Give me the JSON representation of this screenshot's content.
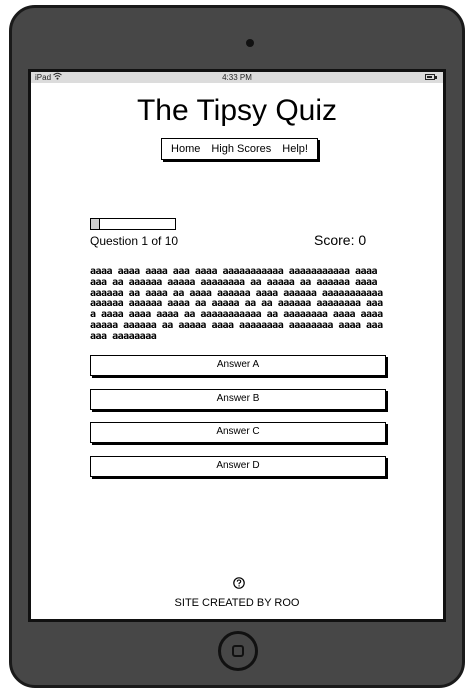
{
  "status_bar": {
    "carrier": "iPad",
    "time": "4:33 PM",
    "wifi_icon": "wifi-icon",
    "battery_icon": "battery-icon"
  },
  "app": {
    "title": "The Tipsy Quiz"
  },
  "nav": {
    "items": [
      "Home",
      "High Scores",
      "Help!"
    ]
  },
  "quiz": {
    "progress_fraction": 0.1,
    "question_counter": "Question 1 of 10",
    "score": "Score: 0",
    "question_text": "aaaa aaaa aaaa aaa aaaa aaaaaaaaaaa aaaaaaaaaaa aaaa aaa aa aaaaaa aaaaa aaaaaaaa aa aaaaa aa aaaaaa aaaa aaaaaa aa aaaa aa aaaa aaaaaa aaaa aaaaaa aaaaaaaaaaa aaaaaa aaaaaa aaaa aa aaaaa aa aa aaaaaa aaaaaaaa aaaa aaaa aaaa aaaa aa aaaaaaaaaaa aa aaaaaaaa aaaa aaaa aaaaa aaaaaa aa aaaaa aaaa aaaaaaaa aaaaaaaa aaaa aaaaaa aaaaaaaa",
    "answers": [
      "Answer A",
      "Answer B",
      "Answer C",
      "Answer D"
    ]
  },
  "footer": {
    "help_icon": "question-circle-icon",
    "credit": "SITE CREATED BY ROO"
  }
}
